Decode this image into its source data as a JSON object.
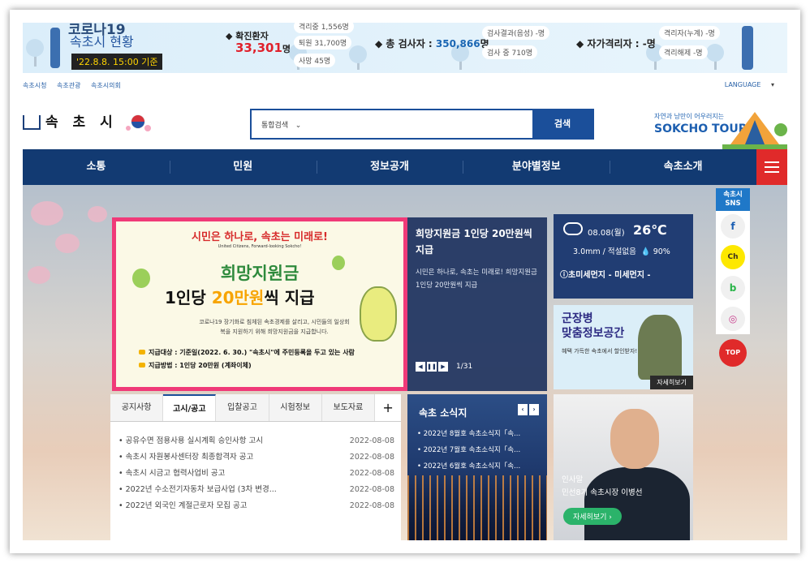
{
  "covid": {
    "title_top": "코로나19",
    "title": "속초시 현황",
    "date": "'22.8.8. 15:00 기준",
    "confirmed_label": "◆ 확진환자",
    "confirmed_value": "33,301",
    "confirmed_unit": "명",
    "stat_pill_1": "격리중 1,556명",
    "stat_pill_2": "퇴원 31,700명",
    "stat_pill_3": "사망 45명",
    "tested_label": "◆ 총 검사자 :",
    "tested_value": "350,866",
    "tested_unit": "명",
    "tested_pill_1": "검사결과(음성) -명",
    "tested_pill_2": "검사 중 710명",
    "self_label": "◆ 자가격리자 : -명",
    "self_pill_1": "격리자(누계) -명",
    "self_pill_2": "격리해제 -명"
  },
  "toplinks": [
    "속초시청",
    "속초관광",
    "속초시의회"
  ],
  "language": "LANGUAGE",
  "logo": "속 초 시",
  "search": {
    "scope": "통합검색",
    "button": "검색"
  },
  "tour": {
    "slogan": "자연과 낭만이 어우러지는",
    "name": "SOKCHO TOUR"
  },
  "nav": [
    "소통",
    "민원",
    "정보공개",
    "분야별정보",
    "속초소개"
  ],
  "slide": {
    "headline": "시민은 하나로, 속초는 미래로!",
    "headline_en": "United Citizens, Forward-looking Sokcho!",
    "main1": "희망지원금",
    "main2_a": "1인당 ",
    "main2_b": "20만원",
    "main2_c": "씩 지급",
    "desc": "코로나19 장기화로 침체된 속초경제를 살리고, 시민들의 일상회복을 지원하기 위해 희망지원금을 지급합니다.",
    "bullet1": "지급대상 : 기준일(2022. 6. 30.) \"속초시\"에 주민등록을 두고 있는 사람",
    "bullet2": "지급방법 : 1인당 20만원 (계좌이체)"
  },
  "slide_info": {
    "title": "희망지원금 1인당 20만원씩 지급",
    "desc": "시민은 하나로, 속초는 미래로! 희망지원금 1인당 20만원씩 지급",
    "page": "1/31"
  },
  "weather": {
    "date": "08.08(월)",
    "temp": "26℃",
    "rain": "3.0mm / 적설없음",
    "humidity": "90%",
    "dust": "초미세먼지  -  미세먼지  -"
  },
  "military": {
    "title1": "군장병",
    "title2": "맞춤정보공간",
    "sub": "혜택 가득한 속초에서 할인받자!",
    "button": "자세히보기"
  },
  "tabs": [
    "공지사항",
    "고시/공고",
    "입찰공고",
    "시험정보",
    "보도자료"
  ],
  "tab_plus": "+",
  "notices": [
    {
      "title": "공유수면 점용사용 실시계획 승인사항 고시",
      "date": "2022-08-08"
    },
    {
      "title": "속초시 자원봉사센터장 최종합격자 공고",
      "date": "2022-08-08"
    },
    {
      "title": "속초시 시금고 협력사업비 공고",
      "date": "2022-08-08"
    },
    {
      "title": "2022년 수소전기자동차 보급사업 (3차 변경...",
      "date": "2022-08-08"
    },
    {
      "title": "2022년 외국인 계절근로자 모집 공고",
      "date": "2022-08-08"
    }
  ],
  "news": {
    "title": "속초 소식지",
    "items": [
      "2022년 8월호 속초소식지「속...",
      "2022년 7월호 속초소식지「속...",
      "2022년 6월호 속초소식지「속..."
    ]
  },
  "mayor": {
    "line1": "인사말",
    "line2": "민선8기 속초시장 이병선",
    "button": "자세히보기 ›"
  },
  "sns": {
    "header": "속초시 SNS",
    "icons": [
      "f",
      "Ch",
      "b",
      "◎"
    ],
    "top": "TOP"
  }
}
